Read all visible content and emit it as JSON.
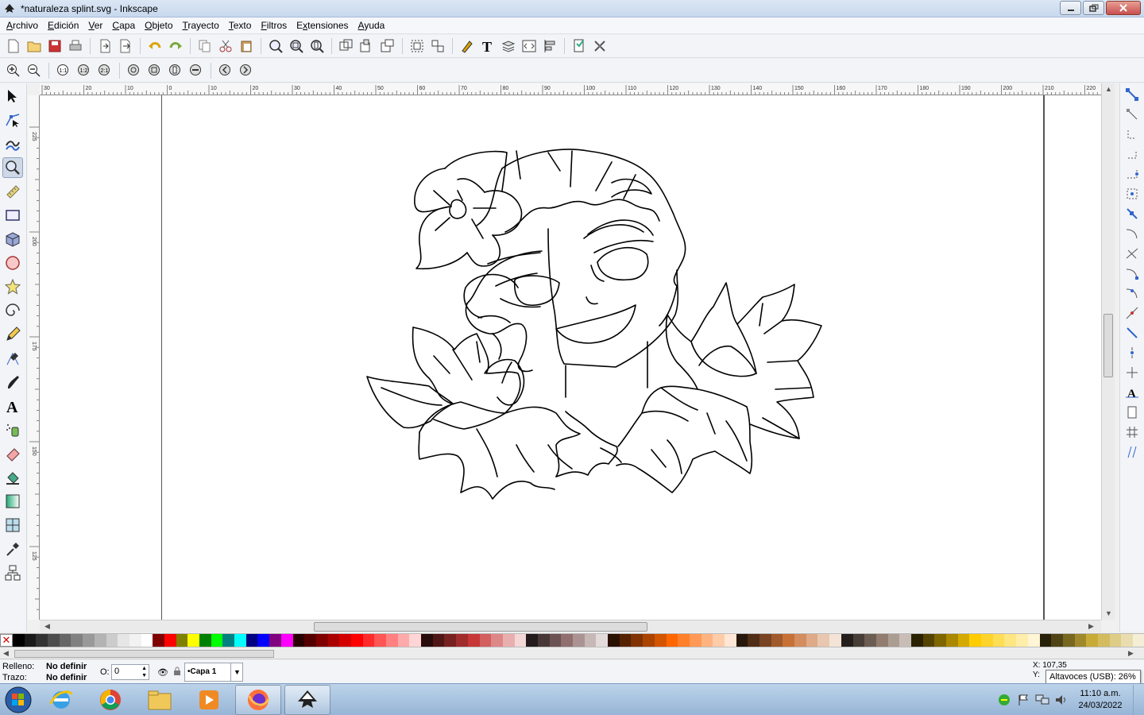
{
  "window": {
    "title": "*naturaleza splint.svg - Inkscape"
  },
  "menu": [
    {
      "label": "Archivo",
      "u": "A",
      "rest": "rchivo"
    },
    {
      "label": "Edición",
      "u": "E",
      "rest": "dición"
    },
    {
      "label": "Ver",
      "u": "V",
      "rest": "er"
    },
    {
      "label": "Capa",
      "u": "C",
      "rest": "apa"
    },
    {
      "label": "Objeto",
      "u": "O",
      "rest": "bjeto"
    },
    {
      "label": "Trayecto",
      "u": "T",
      "rest": "rayecto"
    },
    {
      "label": "Texto",
      "u": "T",
      "rest": "exto"
    },
    {
      "label": "Filtros",
      "u": "F",
      "rest": "iltros"
    },
    {
      "label": "Extensiones",
      "u": "x",
      "pre": "E",
      "rest": "tensiones"
    },
    {
      "label": "Ayuda",
      "u": "A",
      "rest": "yuda"
    }
  ],
  "rulers": {
    "h_ticks": [
      "30",
      "20",
      "10",
      "0",
      "10",
      "20",
      "30",
      "40",
      "50",
      "60",
      "70",
      "80",
      "90",
      "100",
      "110",
      "120",
      "130",
      "140",
      "150",
      "160",
      "170",
      "180",
      "190",
      "200",
      "210",
      "220"
    ],
    "v_ticks": [
      "225",
      "200",
      "175",
      "150",
      "125"
    ]
  },
  "status": {
    "fill_label": "Relleno:",
    "fill_value": "No definir",
    "stroke_label": "Trazo:",
    "stroke_value": "No definir",
    "opacity_label": "O:",
    "opacity_value": "0",
    "layer": "•Capa 1",
    "coord_x_label": "X:",
    "coord_x": "107,35",
    "coord_y_label": "Y:",
    "tooltip": "Altavoces (USB): 26%"
  },
  "palette": [
    "#000000",
    "#1a1a1a",
    "#333333",
    "#4d4d4d",
    "#666666",
    "#808080",
    "#999999",
    "#b3b3b3",
    "#cccccc",
    "#e6e6e6",
    "#f2f2f2",
    "#ffffff",
    "#800000",
    "#ff0000",
    "#808000",
    "#ffff00",
    "#008000",
    "#00ff00",
    "#008080",
    "#00ffff",
    "#000080",
    "#0000ff",
    "#800080",
    "#ff00ff",
    "#2b0000",
    "#550000",
    "#800000",
    "#aa0000",
    "#d40000",
    "#ff0000",
    "#ff2a2a",
    "#ff5555",
    "#ff8080",
    "#ffaaaa",
    "#ffd5d5",
    "#280b0b",
    "#501616",
    "#782121",
    "#a02c2c",
    "#c83737",
    "#d35f5f",
    "#de8787",
    "#e9afaf",
    "#f4d7d7",
    "#241c1c",
    "#483737",
    "#6c5353",
    "#916f6f",
    "#ac9393",
    "#c8b7b7",
    "#e3dbdb",
    "#2b1100",
    "#552200",
    "#803300",
    "#aa4400",
    "#d45500",
    "#ff6600",
    "#ff7f2a",
    "#ff9955",
    "#ffb380",
    "#ffccaa",
    "#ffe6d5",
    "#28170b",
    "#502d16",
    "#784421",
    "#a05a2c",
    "#c87137",
    "#d38d5f",
    "#deaa87",
    "#e9c6af",
    "#f4e3d7",
    "#241f1c",
    "#483e37",
    "#6c5d53",
    "#917c6f",
    "#ac9d93",
    "#c8beb7",
    "#2b2200",
    "#554400",
    "#806600",
    "#aa8800",
    "#d4aa00",
    "#ffcc00",
    "#ffd42a",
    "#ffdd55",
    "#ffe680",
    "#ffeeaa",
    "#fff6d5",
    "#28220b",
    "#504416",
    "#786721",
    "#a0892c",
    "#c8ab37",
    "#d3bc5f",
    "#decd87",
    "#e9ddaf",
    "#f4eed7"
  ],
  "taskbar": {
    "clock_time": "11:10 a.m.",
    "clock_date": "24/03/2022"
  },
  "colors": {
    "accent": "#3b6fb6",
    "title_bg": "#c8d8ee",
    "close": "#c75050"
  }
}
